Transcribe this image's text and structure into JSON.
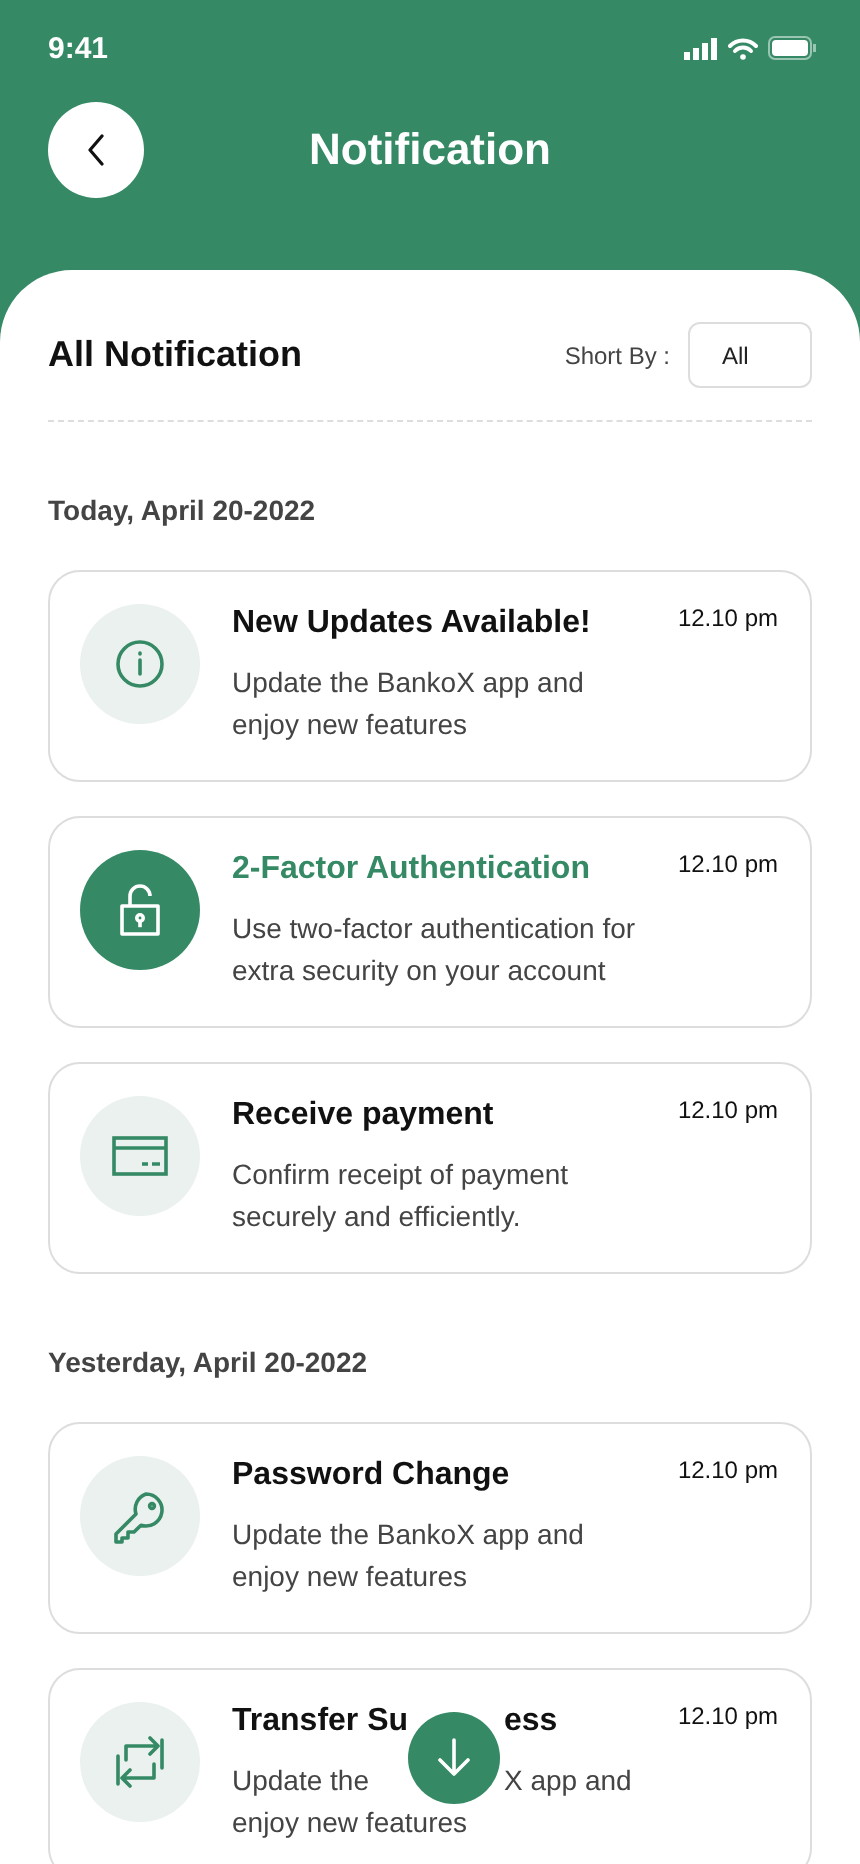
{
  "status_bar": {
    "time": "9:41"
  },
  "header": {
    "title": "Notification"
  },
  "list_header": {
    "title": "All Notification",
    "sort_label": "Short By :",
    "sort_value": "All"
  },
  "groups": [
    {
      "date": "Today, April 20-2022",
      "items": [
        {
          "kind": "info",
          "title": "New Updates Available!",
          "body": "Update the BankoX app and enjoy new features",
          "time": "12.10 pm",
          "selected": false
        },
        {
          "kind": "lock",
          "title": "2-Factor Authentication",
          "body": "Use two-factor authentication for extra security on your account",
          "time": "12.10 pm",
          "selected": true
        },
        {
          "kind": "card",
          "title": "Receive payment",
          "body": "Confirm receipt of payment securely and efficiently.",
          "time": "12.10 pm",
          "selected": false
        }
      ]
    },
    {
      "date": "Yesterday, April 20-2022",
      "items": [
        {
          "kind": "key",
          "title": "Password Change",
          "body": "Update the BankoX app and enjoy new features",
          "time": "12.10 pm",
          "selected": false
        },
        {
          "kind": "transfer",
          "title": "Transfer Su",
          "title_tail": "ess",
          "body": "Update the",
          "body_tail": "X app and",
          "body_more": "enjoy new features",
          "time": "12.10 pm",
          "selected": false
        }
      ]
    }
  ]
}
